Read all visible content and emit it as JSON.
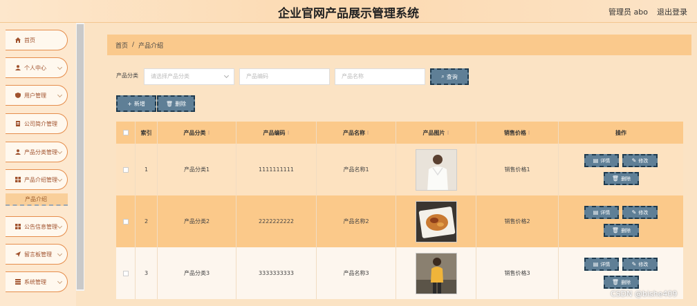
{
  "header": {
    "title": "企业官网产品展示管理系统",
    "user_role": "管理员 abo",
    "logout": "退出登录"
  },
  "sidebar": {
    "items": [
      {
        "label": "首页",
        "icon": "home-icon"
      },
      {
        "label": "个人中心",
        "icon": "user-icon"
      },
      {
        "label": "用户管理",
        "icon": "shield-icon"
      },
      {
        "label": "公司简介管理",
        "icon": "doc-icon"
      },
      {
        "label": "产品分类管理",
        "icon": "user-icon"
      },
      {
        "label": "产品介绍管理",
        "icon": "grid-icon"
      },
      {
        "label": "公告信息管理",
        "icon": "grid-icon"
      },
      {
        "label": "留言板管理",
        "icon": "send-icon"
      },
      {
        "label": "系统管理",
        "icon": "list-icon"
      }
    ],
    "active_sub": "产品介绍"
  },
  "breadcrumb": {
    "home": "首页",
    "sep": "/",
    "current": "产品介绍"
  },
  "filters": {
    "category_label": "产品分类",
    "category_placeholder": "请选择产品分类",
    "code_placeholder": "产品编码",
    "name_placeholder": "产品名称",
    "query": "查询"
  },
  "toolbar": {
    "add": "新增",
    "delete": "删除"
  },
  "table": {
    "headers": [
      "索引",
      "产品分类",
      "产品编码",
      "产品名称",
      "产品图片",
      "销售价格",
      "操作"
    ],
    "rows": [
      {
        "index": "1",
        "category": "产品分类1",
        "code": "1111111111",
        "name": "产品名称1",
        "price": "销售价格1"
      },
      {
        "index": "2",
        "category": "产品分类2",
        "code": "2222222222",
        "name": "产品名称2",
        "price": "销售价格2"
      },
      {
        "index": "3",
        "category": "产品分类3",
        "code": "3333333333",
        "name": "产品名称3",
        "price": "销售价格3"
      }
    ],
    "actions": {
      "detail": "详情",
      "edit": "修改",
      "delete": "删除"
    }
  },
  "watermark": "CSDN @bishe409",
  "colors": {
    "accent": "#fbc98a",
    "button": "#5f7f96",
    "border": "#e58c4a"
  }
}
